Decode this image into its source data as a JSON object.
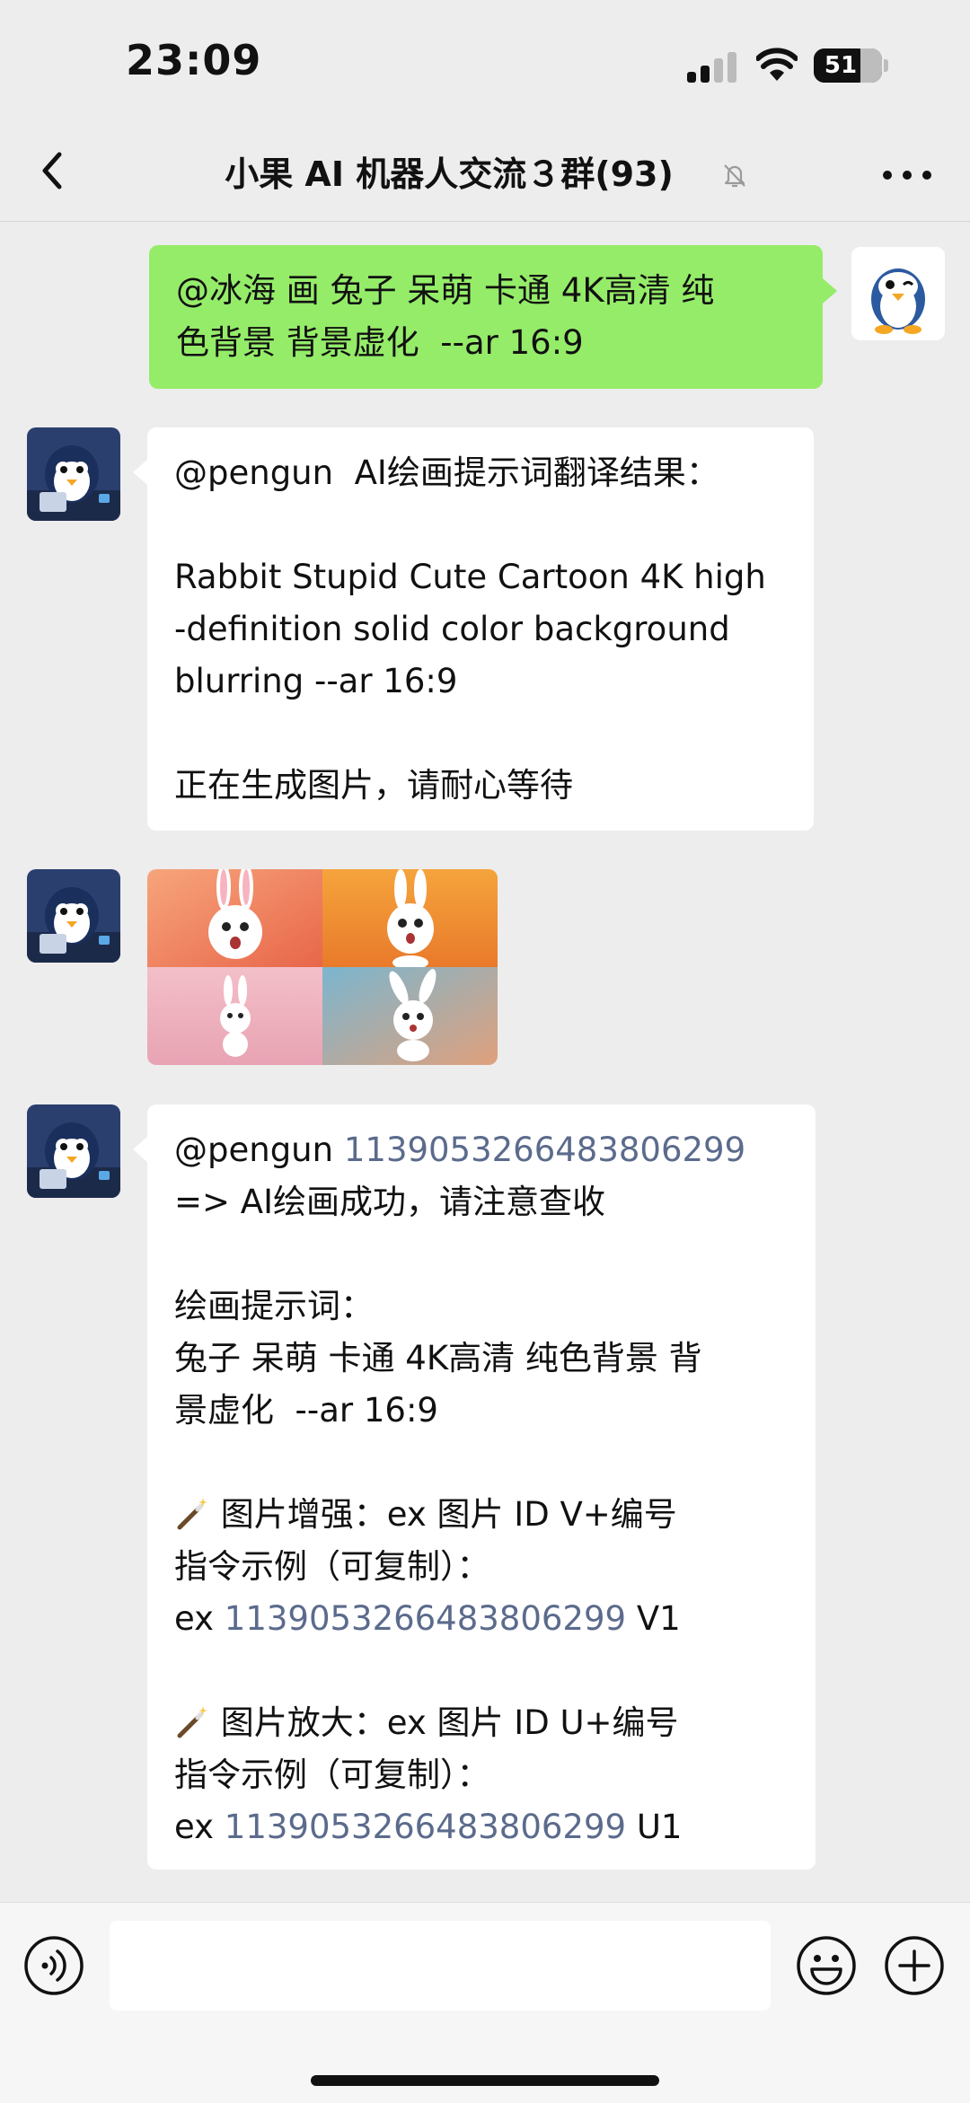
{
  "status_bar": {
    "time": "23:09",
    "battery": "51"
  },
  "nav": {
    "title": "小果 AI 机器人交流３群(93)"
  },
  "messages": [
    {
      "lines": [
        "@冰海 画 兔子 呆萌 卡通 4K高清 纯",
        "色背景 背景虚化  --ar 16:9"
      ]
    },
    {
      "lines": [
        "@pengun  AI绘画提示词翻译结果：",
        "",
        "Rabbit Stupid Cute Cartoon 4K high",
        "-definition solid color background",
        "blurring --ar 16:9",
        "",
        "正在生成图片，请耐心等待"
      ]
    },
    {
      "at_name": "@pengun ",
      "id": "1139053266483806299",
      "line2": "=> AI绘画成功，请注意查收",
      "prompt_label": "绘画提示词：",
      "prompt_line1": "兔子 呆萌 卡通 4K高清 纯色背景 背",
      "prompt_line2": "景虚化  --ar 16:9",
      "enhance_title": " 图片增强：ex 图片 ID V+编号",
      "enhance_example": "指令示例（可复制）：",
      "enhance_prefix": "ex ",
      "enhance_suffix": " V1",
      "upscale_title": " 图片放大：ex 图片 ID U+编号",
      "upscale_example": "指令示例（可复制）：",
      "upscale_prefix": "ex ",
      "upscale_suffix": " U1"
    }
  ],
  "icons": {
    "back": "chevron-left-icon",
    "mute": "bell-slash-icon",
    "more": "ellipsis-icon",
    "voice": "voice-icon",
    "emoji": "smiley-icon",
    "plus": "plus-circle-icon",
    "wand": "magic-wand-icon"
  },
  "colors": {
    "outgoing": "#95ec69",
    "incoming": "#ffffff",
    "link": "#5b6b8c",
    "background": "#ededed"
  }
}
